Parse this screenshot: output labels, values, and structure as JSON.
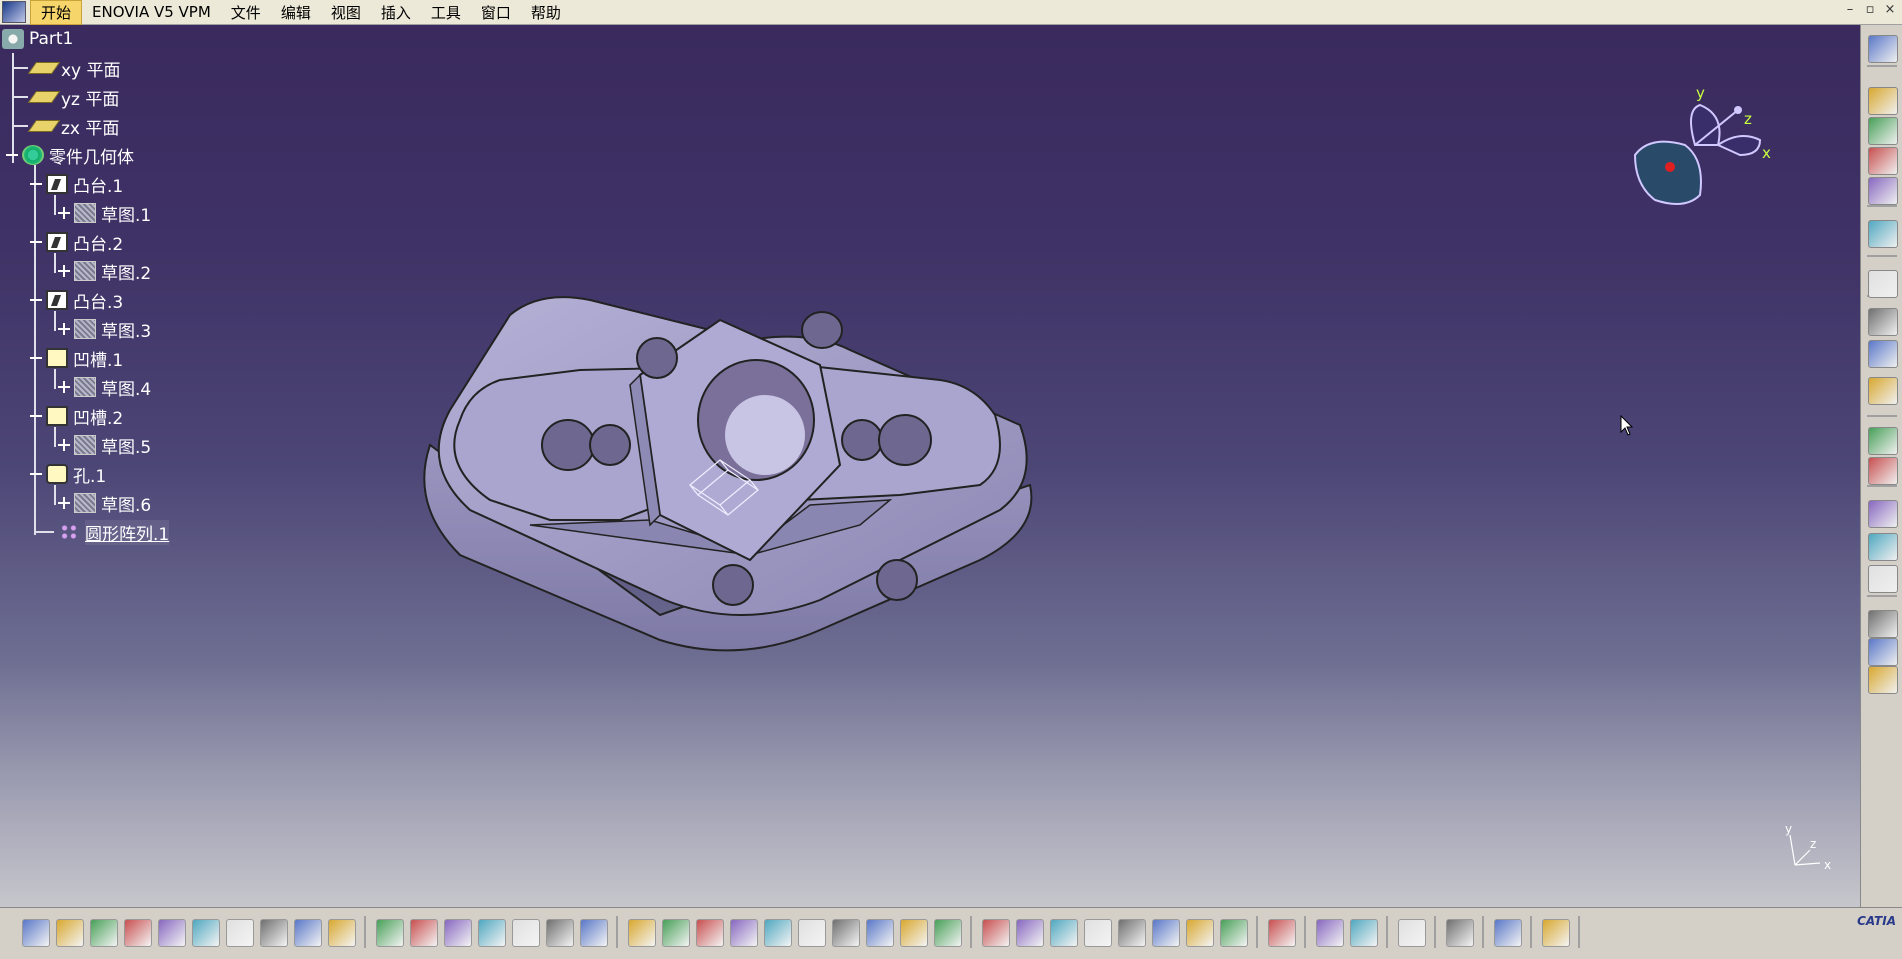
{
  "menu": {
    "start": "开始",
    "items": [
      "ENOVIA V5 VPM",
      "文件",
      "编辑",
      "视图",
      "插入",
      "工具",
      "窗口",
      "帮助"
    ]
  },
  "window_controls": [
    "–",
    "▫",
    "×"
  ],
  "tree": {
    "root": "Part1",
    "planes": [
      "xy 平面",
      "yz 平面",
      "zx 平面"
    ],
    "body": "零件几何体",
    "features": [
      {
        "label": "凸台.1",
        "child": "草图.1",
        "icon": "pad-icon"
      },
      {
        "label": "凸台.2",
        "child": "草图.2",
        "icon": "pad-icon"
      },
      {
        "label": "凸台.3",
        "child": "草图.3",
        "icon": "pad-icon"
      },
      {
        "label": "凹槽.1",
        "child": "草图.4",
        "icon": "pocket-icon"
      },
      {
        "label": "凹槽.2",
        "child": "草图.5",
        "icon": "pocket-icon"
      },
      {
        "label": "孔.1",
        "child": "草图.6",
        "icon": "hole-icon"
      }
    ],
    "pattern": "圆形阵列.1"
  },
  "compass_axes": {
    "x": "x",
    "y": "y",
    "z": "z"
  },
  "mini_axes": {
    "x": "x",
    "y": "y",
    "z": "z"
  },
  "logo": "CATIA",
  "colors": {
    "viewport_top": "#3a2a5e",
    "part_face": "#9e9ac4",
    "tree_text": "#ffffff",
    "active_menu": "#f6d66a"
  },
  "right_toolbar_icons": [
    "gear-icon",
    "view-icon",
    "view-icon",
    "view-icon",
    "view-icon",
    "select-arrow-icon",
    "hand-icon",
    "cube-icon",
    "circle-icon",
    "zoom-icon",
    "grid-icon",
    "frame-icon",
    "abc-icon",
    "measure-icon",
    "stack-icon",
    "part-icon",
    "part-icon",
    "part-icon"
  ],
  "bottom_toolbar_icons": [
    "new-icon",
    "open-icon",
    "save-icon",
    "print-icon",
    "cut-icon",
    "copy-icon",
    "paste-icon",
    "undo-icon",
    "redo-icon",
    "help-icon",
    "formula-icon",
    "speech-icon",
    "disabled-icon",
    "table-icon",
    "tree-icon",
    "lock-icon",
    "align-icon",
    "fly-icon",
    "fit-all-icon",
    "pan-icon",
    "rotate-icon",
    "zoom-in-icon",
    "zoom-out-icon",
    "normal-view-icon",
    "multi-view-icon",
    "iso-view-icon",
    "shading-icon",
    "hide-icon",
    "swap-icon",
    "render-icon",
    "measure-icon",
    "apply-icon",
    "cylinder-icon",
    "camera-icon",
    "update-icon",
    "grab-icon",
    "axis-icon",
    "scale-icon",
    "stack-icon",
    "snap-icon",
    "list-icon",
    "eraser-icon"
  ]
}
